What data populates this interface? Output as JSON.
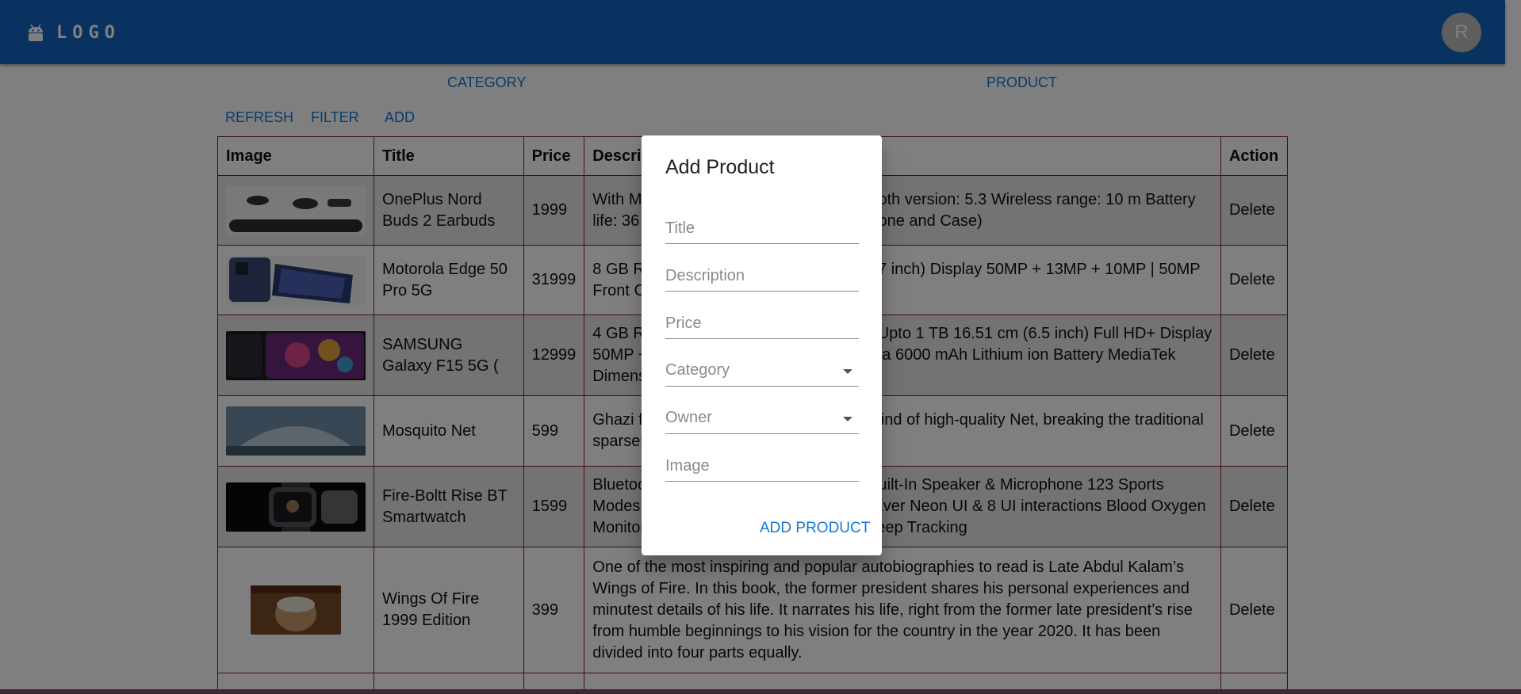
{
  "header": {
    "logo_text": "LOGO",
    "avatar_initial": "R"
  },
  "nav": {
    "category": "CATEGORY",
    "product": "PRODUCT"
  },
  "toolbar": {
    "refresh": "REFRESH",
    "filter": "FILTER",
    "add": "ADD"
  },
  "table": {
    "headers": {
      "image": "Image",
      "title": "Title",
      "price": "Price",
      "description": "Description",
      "action": "Action"
    },
    "rows": [
      {
        "title": "OnePlus Nord Buds 2 Earbuds",
        "price": "1999",
        "description": "With Mic: Yes Connector type: No Bluetooth version: 5.3 Wireless range: 10 m Battery life: 36 Hours (Earphone), 90 min (Earphone and Case)",
        "action": "Delete"
      },
      {
        "title": "Motorola Edge 50 Pro 5G",
        "price": "31999",
        "description": "8 GB RAM | 256 GB ROM 16.94 cm (6.67 inch) Display 50MP + 13MP + 10MP | 50MP Front Camera",
        "action": "Delete"
      },
      {
        "title": "SAMSUNG Galaxy F15 5G (",
        "price": "12999",
        "description": "4 GB RAM | 128 GB ROM | Expandable Upto 1 TB 16.51 cm (6.5 inch) Full HD+ Display 50MP + 5MP + 2MP | 13MP Front Camera 6000 mAh Lithium ion Battery MediaTek Dimensity 6100+ Processor",
        "action": "Delete"
      },
      {
        "title": "Mosquito Net",
        "price": "599",
        "description": "Ghazi foldable mosquito net, made of a kind of high-quality Net, breaking the traditional sparseness",
        "action": "Delete"
      },
      {
        "title": "Fire-Boltt Rise BT Smartwatch",
        "price": "1599",
        "description": "Bluetooth Calling, AI Voice Assistance, Built-In Speaker & Microphone 123 Sports Modes to track your fitness goals | First Ever Neon UI & 8 UI interactions Blood Oxygen Monitoring, 24*7 Heart Rate Tracking, Sleep Tracking",
        "action": "Delete"
      },
      {
        "title": "Wings Of Fire 1999 Edition",
        "price": "399",
        "description": "One of the most inspiring and popular autobiographies to read is Late Abdul Kalam’s Wings of Fire. In this book, the former president shares his personal experiences and minutest details of his life. It narrates his life, right from the former late president’s rise from humble beginnings to his vision for the country in the year 2020. It has been divided into four parts equally.",
        "action": "Delete"
      }
    ]
  },
  "dialog": {
    "title": "Add Product",
    "fields": {
      "title_placeholder": "Title",
      "description_placeholder": "Description",
      "price_placeholder": "Price",
      "category_label": "Category",
      "owner_label": "Owner",
      "image_placeholder": "Image"
    },
    "submit_label": "ADD PRODUCT"
  },
  "colors": {
    "appbar": "#1565c0",
    "accent": "#1976d2",
    "table_border": "#8b1c1c",
    "avatar": "#bdbdbd"
  },
  "icons": {
    "logo": "android-icon",
    "select": "caret-down-icon"
  }
}
